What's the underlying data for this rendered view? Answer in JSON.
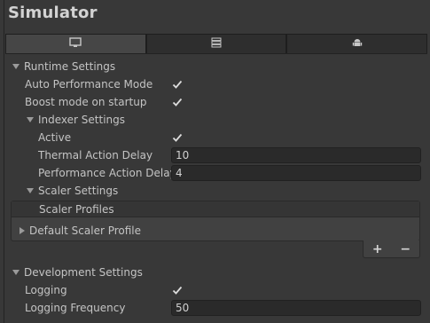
{
  "window": {
    "title": "Simulator"
  },
  "tabs": [
    {
      "icon": "monitor-icon"
    },
    {
      "icon": "device-list-icon"
    },
    {
      "icon": "android-icon"
    }
  ],
  "runtime": {
    "label": "Runtime Settings",
    "auto_performance_mode": {
      "label": "Auto Performance Mode",
      "checked": true
    },
    "boost_mode": {
      "label": "Boost mode on startup",
      "checked": true
    },
    "indexer": {
      "label": "Indexer Settings",
      "active": {
        "label": "Active",
        "checked": true
      },
      "thermal_action_delay": {
        "label": "Thermal Action Delay",
        "value": "10"
      },
      "performance_action_delay": {
        "label": "Performance Action Delay",
        "value": "4"
      }
    },
    "scaler": {
      "label": "Scaler Settings",
      "profiles_header": "Scaler Profiles",
      "default_profile": "Default Scaler Profile",
      "add_label": "+",
      "remove_label": "−"
    }
  },
  "development": {
    "label": "Development Settings",
    "logging": {
      "label": "Logging",
      "checked": true
    },
    "logging_frequency": {
      "label": "Logging Frequency",
      "value": "50"
    }
  }
}
